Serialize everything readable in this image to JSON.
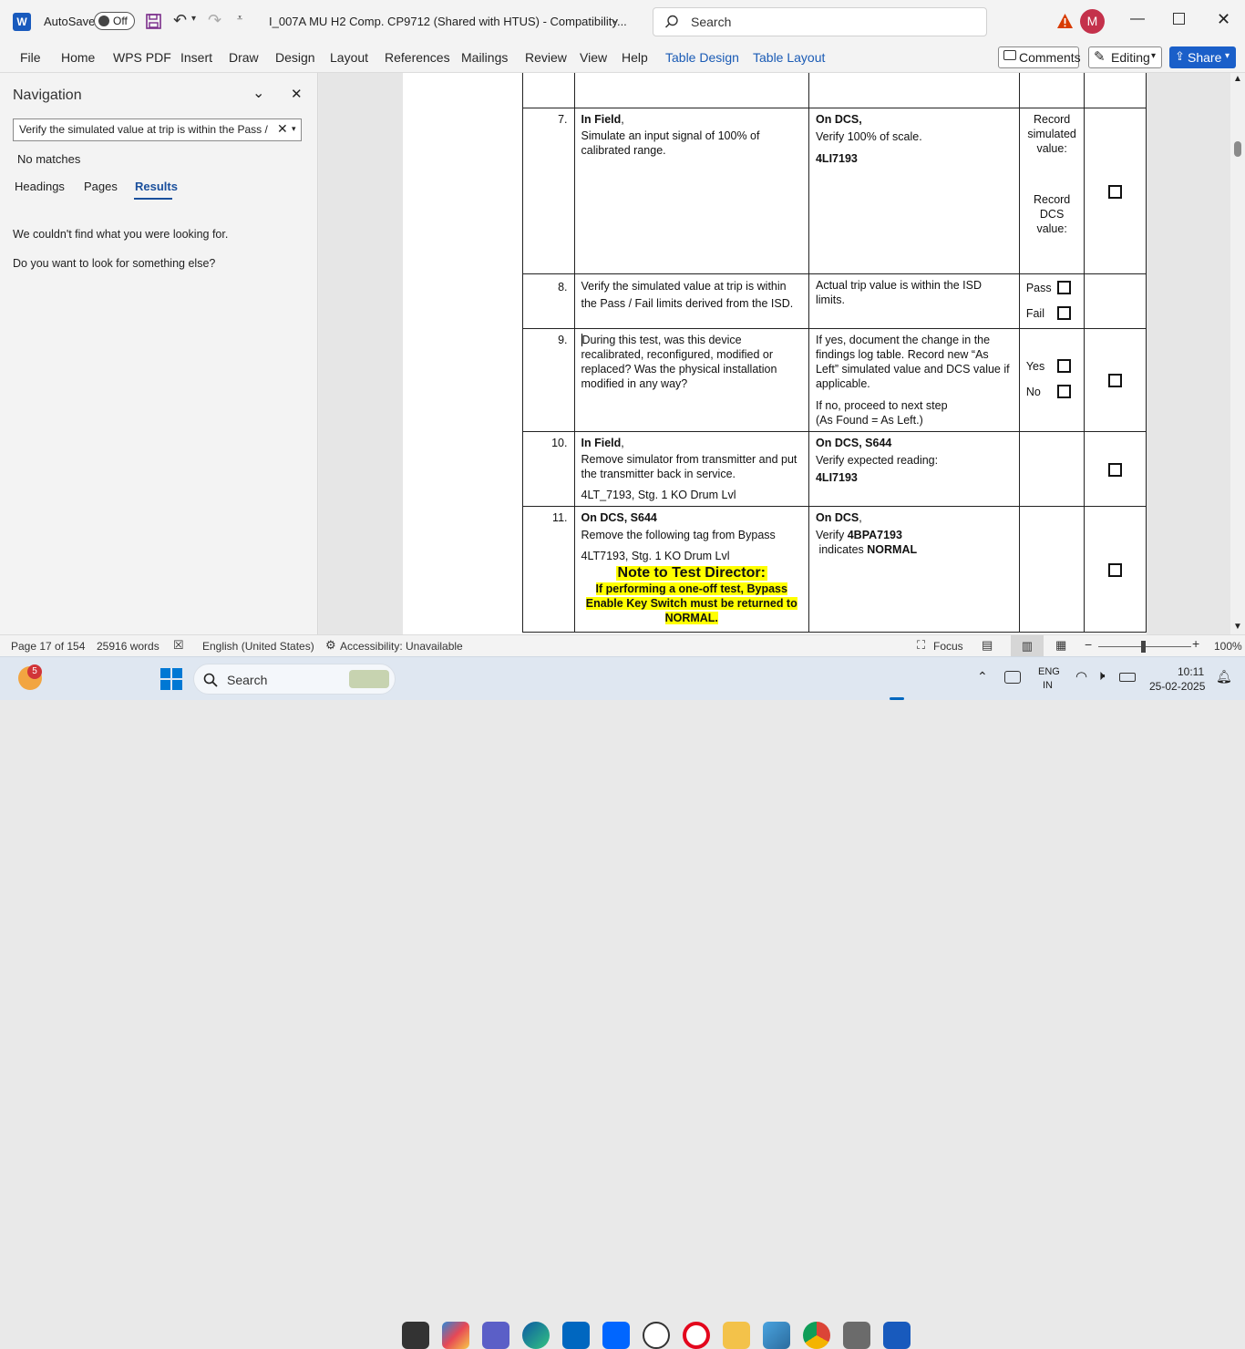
{
  "titlebar": {
    "autosave_label": "AutoSave",
    "autosave_state": "Off",
    "doc_title": "I_007A MU H2 Comp. CP9712 (Shared with HTUS)  -  Compatibility...",
    "search_placeholder": "Search",
    "avatar_initial": "M"
  },
  "ribbon": {
    "tabs": [
      "File",
      "Home",
      "WPS PDF",
      "Insert",
      "Draw",
      "Design",
      "Layout",
      "References",
      "Mailings",
      "Review",
      "View",
      "Help",
      "Table Design",
      "Table Layout"
    ],
    "comments_label": "Comments",
    "editing_label": "Editing",
    "share_label": "Share"
  },
  "navigation": {
    "title": "Navigation",
    "search_value": "Verify the simulated value at trip is within the Pass /",
    "no_matches": "No matches",
    "tabs": [
      "Headings",
      "Pages",
      "Results"
    ],
    "active_tab": "Results",
    "message1": "We couldn't find what you were looking for.",
    "message2": "Do you want to look for something else?"
  },
  "document": {
    "rows": [
      {
        "num": "",
        "action_html": "",
        "verify_html": "",
        "record": ""
      },
      {
        "num": "7.",
        "action_bold": "In Field",
        "action_rest": ",",
        "action_text": "Simulate an input signal of 100% of calibrated range.",
        "verify_bold": "On DCS,",
        "verify_text": "Verify 100% of scale.",
        "verify_tag": "4LI7193",
        "record_a": "Record simulated value:",
        "record_b": "Record DCS value:"
      },
      {
        "num": "8.",
        "action_text": "Verify the simulated value at trip is within the Pass / Fail limits derived from the ISD.",
        "verify_text": "Actual trip value is within the ISD limits.",
        "opt1": "Pass",
        "opt2": "Fail"
      },
      {
        "num": "9.",
        "action_text": "During this test, was this device recalibrated, reconfigured, modified or replaced? Was the physical installation modified in any way?",
        "verify_text": "If yes, document the change in the findings log table. Record new “As Left” simulated value and DCS value if applicable.",
        "verify_text2": "If no, proceed to next step",
        "verify_text3": "(As Found = As Left.)",
        "opt1": "Yes",
        "opt2": "No"
      },
      {
        "num": "10.",
        "action_bold": "In Field",
        "action_rest": ",",
        "action_text": "Remove simulator from transmitter and put the transmitter back in service.",
        "action_text2": "4LT_7193, Stg. 1 KO Drum Lvl",
        "verify_bold": "On DCS, S644",
        "verify_text": "Verify expected reading:",
        "verify_tag": "4LI7193"
      },
      {
        "num": "11.",
        "action_bold": "On DCS, S644",
        "action_text": "Remove the following tag from Bypass",
        "action_text2": "4LT7193, Stg. 1 KO Drum Lvl",
        "note_title": "Note to Test Director:",
        "note_body": "If performing a one-off test, Bypass Enable Key Switch must be returned to NORMAL.",
        "verify_bold": "On DCS",
        "verify_rest": ",",
        "verify_pre": "Verify ",
        "verify_tag": "4BPA7193",
        "verify_post_pre": " indicates ",
        "verify_post_bold": "NORMAL"
      }
    ]
  },
  "status": {
    "page": "Page 17 of 154",
    "words": "25916 words",
    "language": "English (United States)",
    "accessibility": "Accessibility: Unavailable",
    "focus": "Focus",
    "zoom": "100%"
  },
  "taskbar": {
    "badge": "5",
    "search": "Search",
    "lang1": "ENG",
    "lang2": "IN",
    "time": "10:11",
    "date": "25-02-2025"
  },
  "colors": {
    "accent": "#185abd",
    "share_bg": "#1a5fc9",
    "avatar_bg": "#c4314b",
    "highlight": "#ffff00"
  }
}
